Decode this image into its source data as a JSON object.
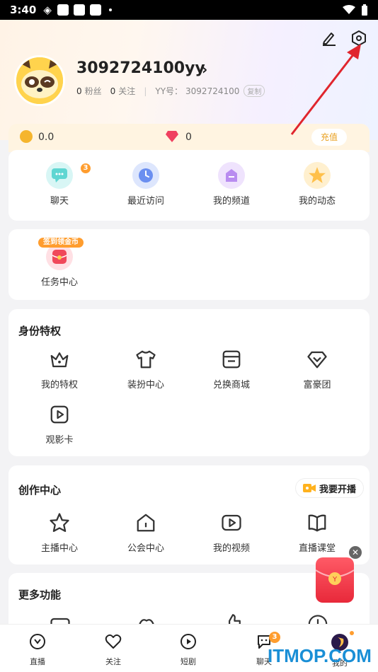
{
  "status_bar": {
    "time": "3:40"
  },
  "profile": {
    "username": "3092724100yy",
    "fans_count": "0",
    "fans_label": "粉丝",
    "follow_count": "0",
    "follow_label": "关注",
    "yy_label": "YY号：",
    "yy_number": "3092724100",
    "copy_label": "复制"
  },
  "wallet": {
    "coins": "0.0",
    "diamonds": "0",
    "recharge_label": "充值"
  },
  "quick": [
    {
      "label": "聊天",
      "badge": "3",
      "icon": "chat-icon",
      "color": "#5fd6d2"
    },
    {
      "label": "最近访问",
      "icon": "clock-icon",
      "color": "#6b8ff0"
    },
    {
      "label": "我的频道",
      "icon": "channel-icon",
      "color": "#b98cf0"
    },
    {
      "label": "我的动态",
      "icon": "star-icon",
      "color": "#ffc04a"
    }
  ],
  "tasks": {
    "badge": "签到领金币",
    "label": "任务中心"
  },
  "identity": {
    "title": "身份特权",
    "items": [
      {
        "label": "我的特权",
        "icon": "crown-icon"
      },
      {
        "label": "装扮中心",
        "icon": "shirt-icon"
      },
      {
        "label": "兑换商城",
        "icon": "store-icon"
      },
      {
        "label": "富豪团",
        "icon": "diamond-icon"
      },
      {
        "label": "观影卡",
        "icon": "movie-card-icon"
      }
    ]
  },
  "creation": {
    "title": "创作中心",
    "live_button": "我要开播",
    "items": [
      {
        "label": "主播中心",
        "icon": "star-outline-icon"
      },
      {
        "label": "公会中心",
        "icon": "guild-icon"
      },
      {
        "label": "我的视频",
        "icon": "video-icon"
      },
      {
        "label": "直播课堂",
        "icon": "book-icon"
      }
    ]
  },
  "more": {
    "title": "更多功能"
  },
  "tabs": [
    {
      "label": "直播",
      "icon": "live-tab-icon"
    },
    {
      "label": "关注",
      "icon": "heart-tab-icon"
    },
    {
      "label": "短剧",
      "icon": "play-tab-icon"
    },
    {
      "label": "聊天",
      "icon": "chat-tab-icon",
      "badge": "3"
    },
    {
      "label": "我的",
      "icon": "me-tab-icon"
    }
  ],
  "watermark": "ITMOP.COM"
}
